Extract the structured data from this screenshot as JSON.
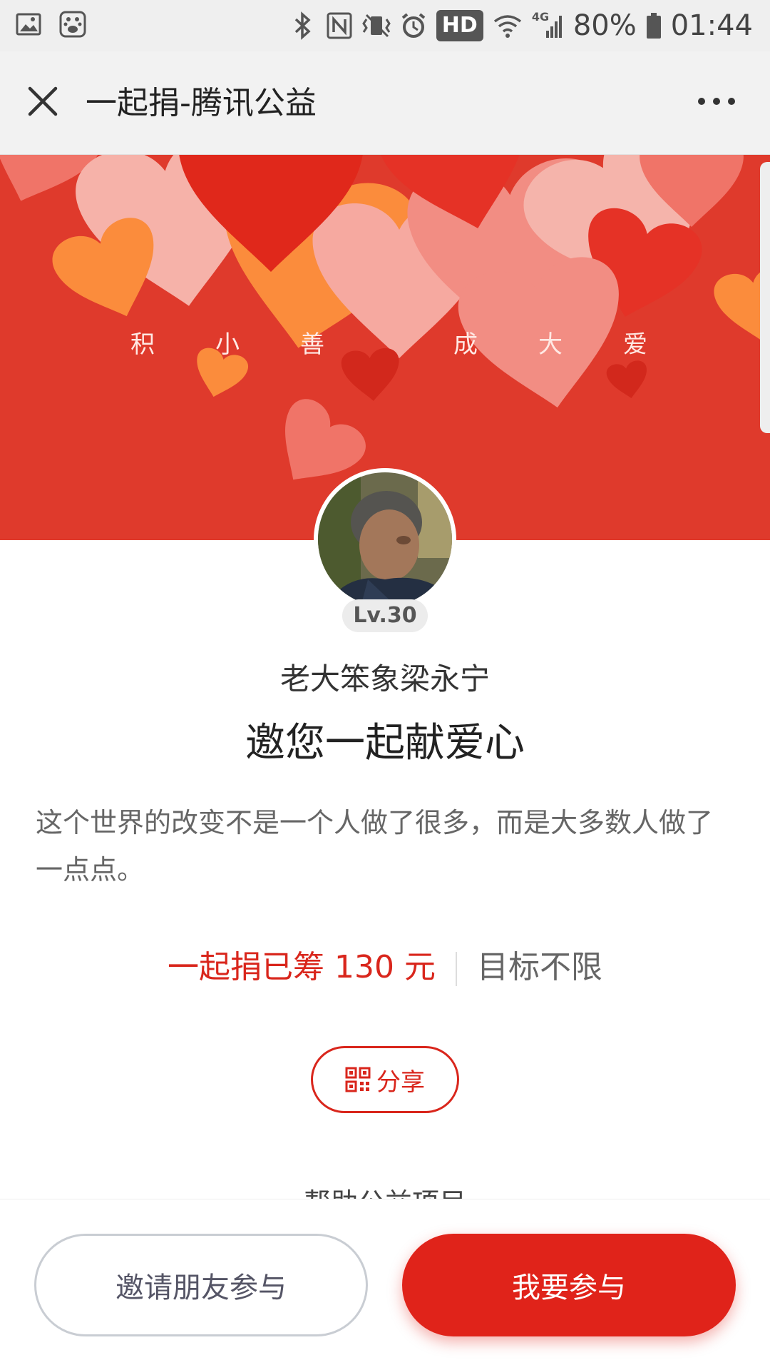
{
  "status_bar": {
    "left_icons": [
      "gallery-icon",
      "baidu-icon"
    ],
    "right_icons": [
      "bluetooth-icon",
      "nfc-icon",
      "vibrate-icon",
      "alarm-icon"
    ],
    "hd_label": "HD",
    "network_label": "4G",
    "battery": "80%",
    "time": "01:44"
  },
  "title_bar": {
    "title": "一起捐-腾讯公益",
    "close_icon": "close-icon",
    "more_icon": "more-icon"
  },
  "banner": {
    "slogan": [
      "积",
      "小",
      "善",
      "成",
      "大",
      "爱"
    ],
    "colors": {
      "background": "#df3a2c",
      "orange": "#fb8c3c",
      "pink": "#f6a9a0",
      "red": "#e0281b"
    }
  },
  "profile": {
    "level": "Lv.30",
    "inviter_name": "老大笨象梁永宁",
    "headline": "邀您一起献爱心",
    "quote": "这个世界的改变不是一个人做了很多，而是大多数人做了一点点。"
  },
  "fundraising": {
    "raised_text": "一起捐已筹 130 元",
    "goal_text": "目标不限"
  },
  "share_button": {
    "label": "分享",
    "icon": "qrcode-icon"
  },
  "section_title": "帮助公益项目",
  "bottom_actions": {
    "invite_label": "邀请朋友参与",
    "join_label": "我要参与"
  },
  "accent_color": "#d9261c"
}
